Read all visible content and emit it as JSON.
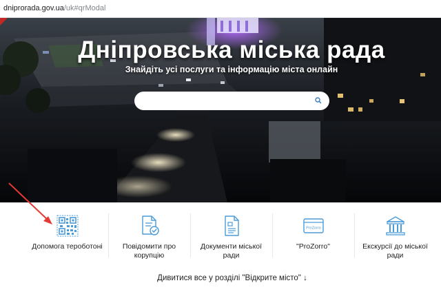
{
  "browser": {
    "url_domain": "dniprorada.gov.ua",
    "url_path": "/uk#qrModal"
  },
  "hero": {
    "title": "Дніпровська міська рада",
    "subtitle": "Знайдіть усі послуги та інформацію міста онлайн",
    "search_placeholder": "",
    "search_icon": "search-icon"
  },
  "services": [
    {
      "label": "Допомога тероботоні",
      "icon": "qr-code-icon"
    },
    {
      "label": "Повідомити про корупцію",
      "icon": "document-check-icon"
    },
    {
      "label": "Документи міської ради",
      "icon": "document-icon"
    },
    {
      "label": "\"ProZorro\"",
      "icon": "prozorro-icon"
    },
    {
      "label": "Екскурсії до міської ради",
      "icon": "building-icon"
    }
  ],
  "more_link": "Дивитися все у розділі \"Відкрите місто\" ↓",
  "colors": {
    "accent": "#4a9bd9",
    "annotation_arrow": "#e53935",
    "hero_bg": "#08090c"
  }
}
